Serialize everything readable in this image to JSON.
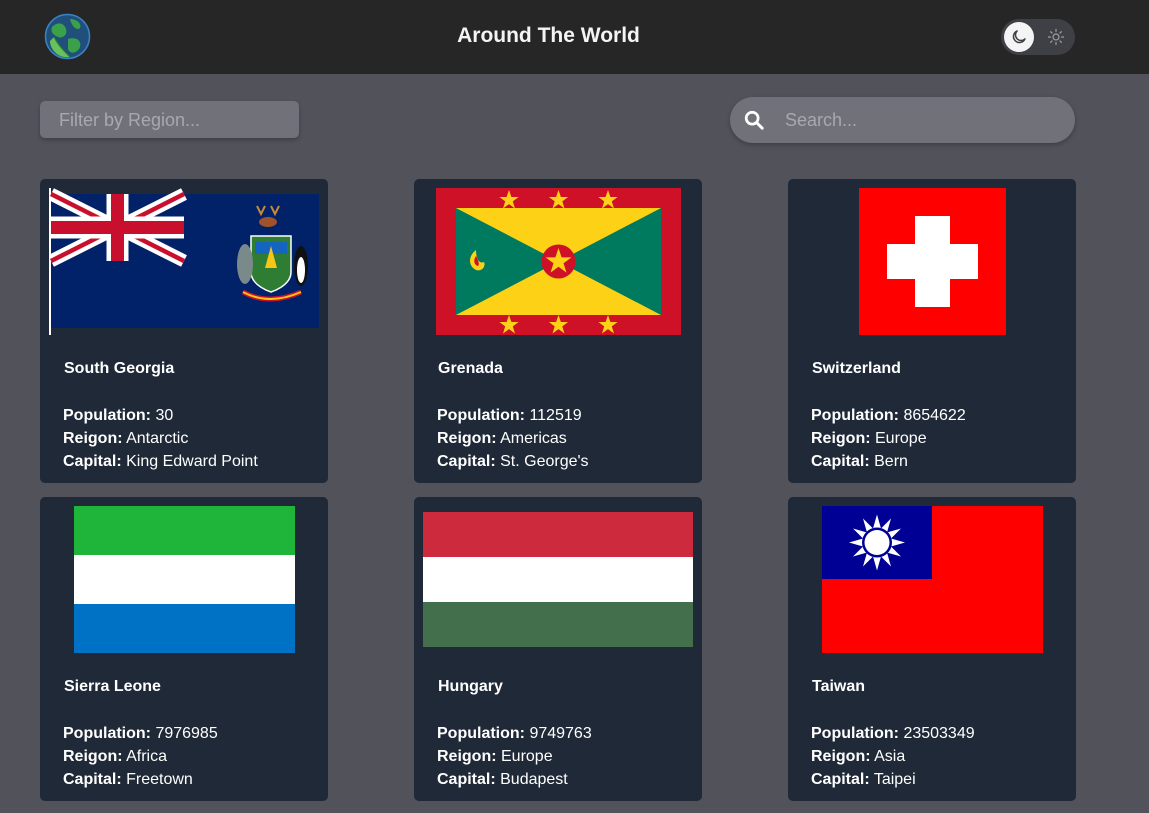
{
  "header": {
    "title": "Around The World",
    "logo_icon": "globe-icon",
    "theme": {
      "dark_icon": "moon-icon",
      "light_icon": "sun-icon",
      "active": "dark"
    }
  },
  "controls": {
    "filter_placeholder": "Filter by Region...",
    "search_placeholder": "Search...",
    "search_icon": "search-icon"
  },
  "labels": {
    "population": "Population:",
    "region": "Reigon:",
    "capital": "Capital:"
  },
  "countries": [
    {
      "name": "South Georgia",
      "population": "30",
      "region": "Antarctic",
      "capital": "King Edward Point"
    },
    {
      "name": "Grenada",
      "population": "112519",
      "region": "Americas",
      "capital": "St. George's"
    },
    {
      "name": "Switzerland",
      "population": "8654622",
      "region": "Europe",
      "capital": "Bern"
    },
    {
      "name": "Sierra Leone",
      "population": "7976985",
      "region": "Africa",
      "capital": "Freetown"
    },
    {
      "name": "Hungary",
      "population": "9749763",
      "region": "Europe",
      "capital": "Budapest"
    },
    {
      "name": "Taiwan",
      "population": "23503349",
      "region": "Asia",
      "capital": "Taipei"
    }
  ],
  "colors": {
    "page_bg": "#52525b",
    "header_bg": "#262626",
    "card_bg": "#1f2937",
    "input_bg": "#71717a"
  }
}
